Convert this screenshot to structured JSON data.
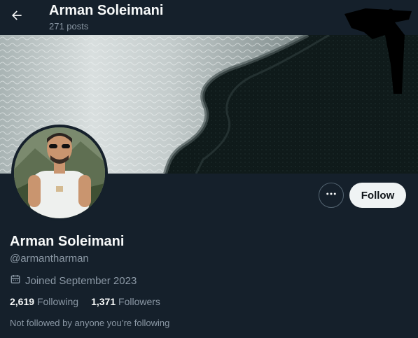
{
  "header": {
    "title": "Arman Soleimani",
    "posts_count": "271 posts",
    "back_icon": "arrow-left-icon"
  },
  "banner": {
    "description_icon": "ocean-shore-photo"
  },
  "actions": {
    "more_icon": "more-horizontal-icon",
    "follow_label": "Follow"
  },
  "profile": {
    "display_name": "Arman Soleimani",
    "handle": "@armantharman",
    "joined": "Joined September 2023",
    "calendar_icon": "calendar-icon",
    "following_count": "2,619",
    "following_label": "Following",
    "followers_count": "1,371",
    "followers_label": "Followers",
    "note": "Not followed by anyone you’re following"
  },
  "colors": {
    "background": "#15202b",
    "primary_text": "#f7f9f9",
    "secondary_text": "#8b98a5",
    "button_bg": "#eff3f4",
    "button_text": "#0f1419",
    "border": "#536471"
  }
}
